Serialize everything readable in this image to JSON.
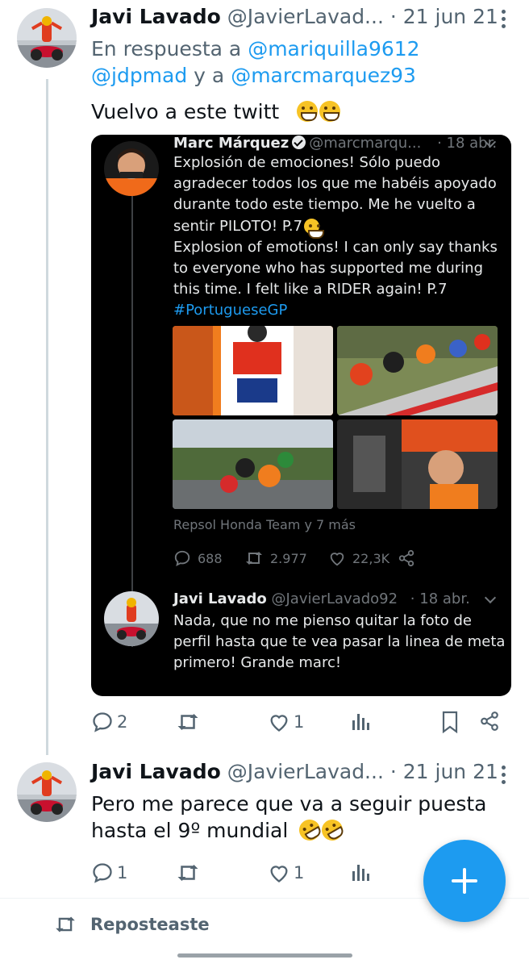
{
  "tweet1": {
    "name": "Javi Lavado",
    "handle": "@JavierLavad...",
    "date": "· 21 jun 21",
    "reply_prefix": "En respuesta a ",
    "reply_user1": "@mariquilla9612",
    "reply_user2": "@jdpmad",
    "reply_connector": " y a ",
    "reply_user3": "@marcmarquez93",
    "text": "Vuelvo a este twitt",
    "emojis": [
      "grinning-face",
      "grinning-face"
    ],
    "actions": {
      "replies": "2",
      "reposts": "",
      "likes": "1"
    }
  },
  "embed": {
    "name": "Marc Márquez",
    "handle": "@marcmarqu...",
    "date": "· 18 abr.",
    "text_es": "Explosión de emociones! Sólo puedo agradecer todos los que me habéis apoyado durante todo este tiempo. Me he vuelto a sentir PILOTO! P.7",
    "text_en": "Explosion of emotions! I can only say thanks to everyone who has supported me during this time. I felt like a RIDER again! P.7",
    "hashtag": "#PortugueseGP",
    "photo_credit": "Repsol Honda Team y 7 más",
    "stats": {
      "replies": "688",
      "retweets": "2.977",
      "likes": "22,3K"
    },
    "reply": {
      "name": "Javi Lavado",
      "handle": "@JavierLavado92",
      "date": "· 18 abr.",
      "text": "Nada, que no me pienso quitar la foto de perfil hasta que te vea pasar la linea de meta primero! Grande marc!"
    }
  },
  "tweet2": {
    "name": "Javi Lavado",
    "handle": "@JavierLavad...",
    "date": "· 21 jun 21",
    "text_line1": "Pero me parece que va a seguir puesta",
    "text_line2": "hasta el 9º mundial",
    "emojis": [
      "rolling-on-floor-laughing",
      "rolling-on-floor-laughing"
    ],
    "actions": {
      "replies": "1",
      "reposts": "",
      "likes": "1"
    }
  },
  "footer": {
    "repost_label": "Reposteaste"
  },
  "colors": {
    "accent": "#1d9bf0",
    "muted": "#536471",
    "text": "#0f1419"
  }
}
